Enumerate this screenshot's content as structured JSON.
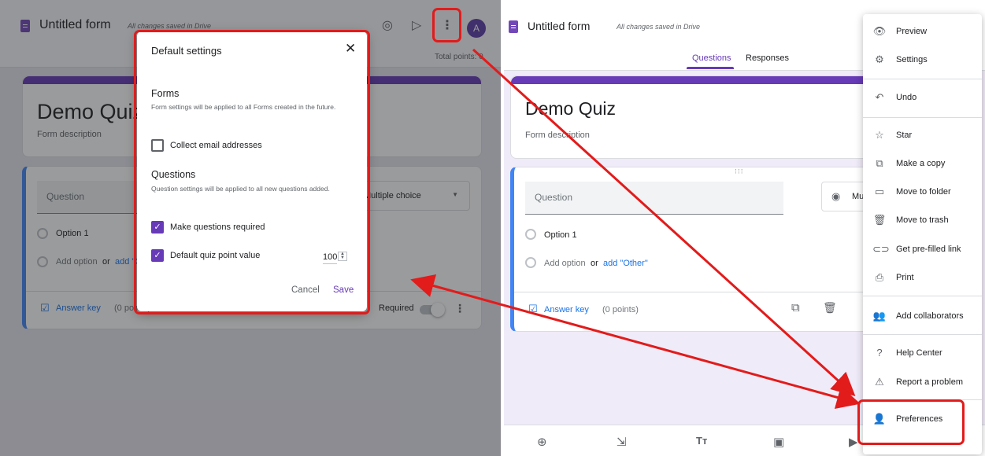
{
  "left": {
    "form_title": "Untitled form",
    "saved_status": "All changes saved in Drive",
    "avatar_letter": "A",
    "total_points": "Total points: 0",
    "quiz_title": "Demo Quiz",
    "form_description": "Form description",
    "question_placeholder": "Question",
    "question_type": "Multiple choice",
    "option1": "Option 1",
    "add_option": "Add option",
    "or": "or",
    "add_other": "add \"Other\"",
    "answer_key": "Answer key",
    "points": "(0 points)",
    "required": "Required"
  },
  "dialog": {
    "title": "Default settings",
    "forms_heading": "Forms",
    "forms_desc": "Form settings will be applied to all Forms created in the future.",
    "collect_email": "Collect email addresses",
    "questions_heading": "Questions",
    "questions_desc": "Question settings will be applied to all new questions added.",
    "make_required": "Make questions required",
    "default_points_label": "Default quiz point value",
    "default_points_value": "100",
    "cancel": "Cancel",
    "save": "Save"
  },
  "right": {
    "form_title": "Untitled form",
    "saved_status": "All changes saved in Drive",
    "tabs": [
      "Questions",
      "Responses"
    ],
    "quiz_title": "Demo Quiz",
    "form_description": "Form description",
    "question_placeholder": "Question",
    "question_type": "Mu",
    "option1": "Option 1",
    "add_option": "Add option",
    "or": "or",
    "add_other": "add \"Other\"",
    "answer_key": "Answer key",
    "points": "(0 points)"
  },
  "menu": {
    "items": [
      "Preview",
      "Settings",
      "Undo",
      "Star",
      "Make a copy",
      "Move to folder",
      "Move to trash",
      "Get pre-filled link",
      "Print",
      "Add collaborators",
      "Help Center",
      "Report a problem",
      "Preferences"
    ]
  },
  "colors": {
    "accent": "#673ab7",
    "highlight": "#e21b1b",
    "link": "#1a73e8"
  }
}
